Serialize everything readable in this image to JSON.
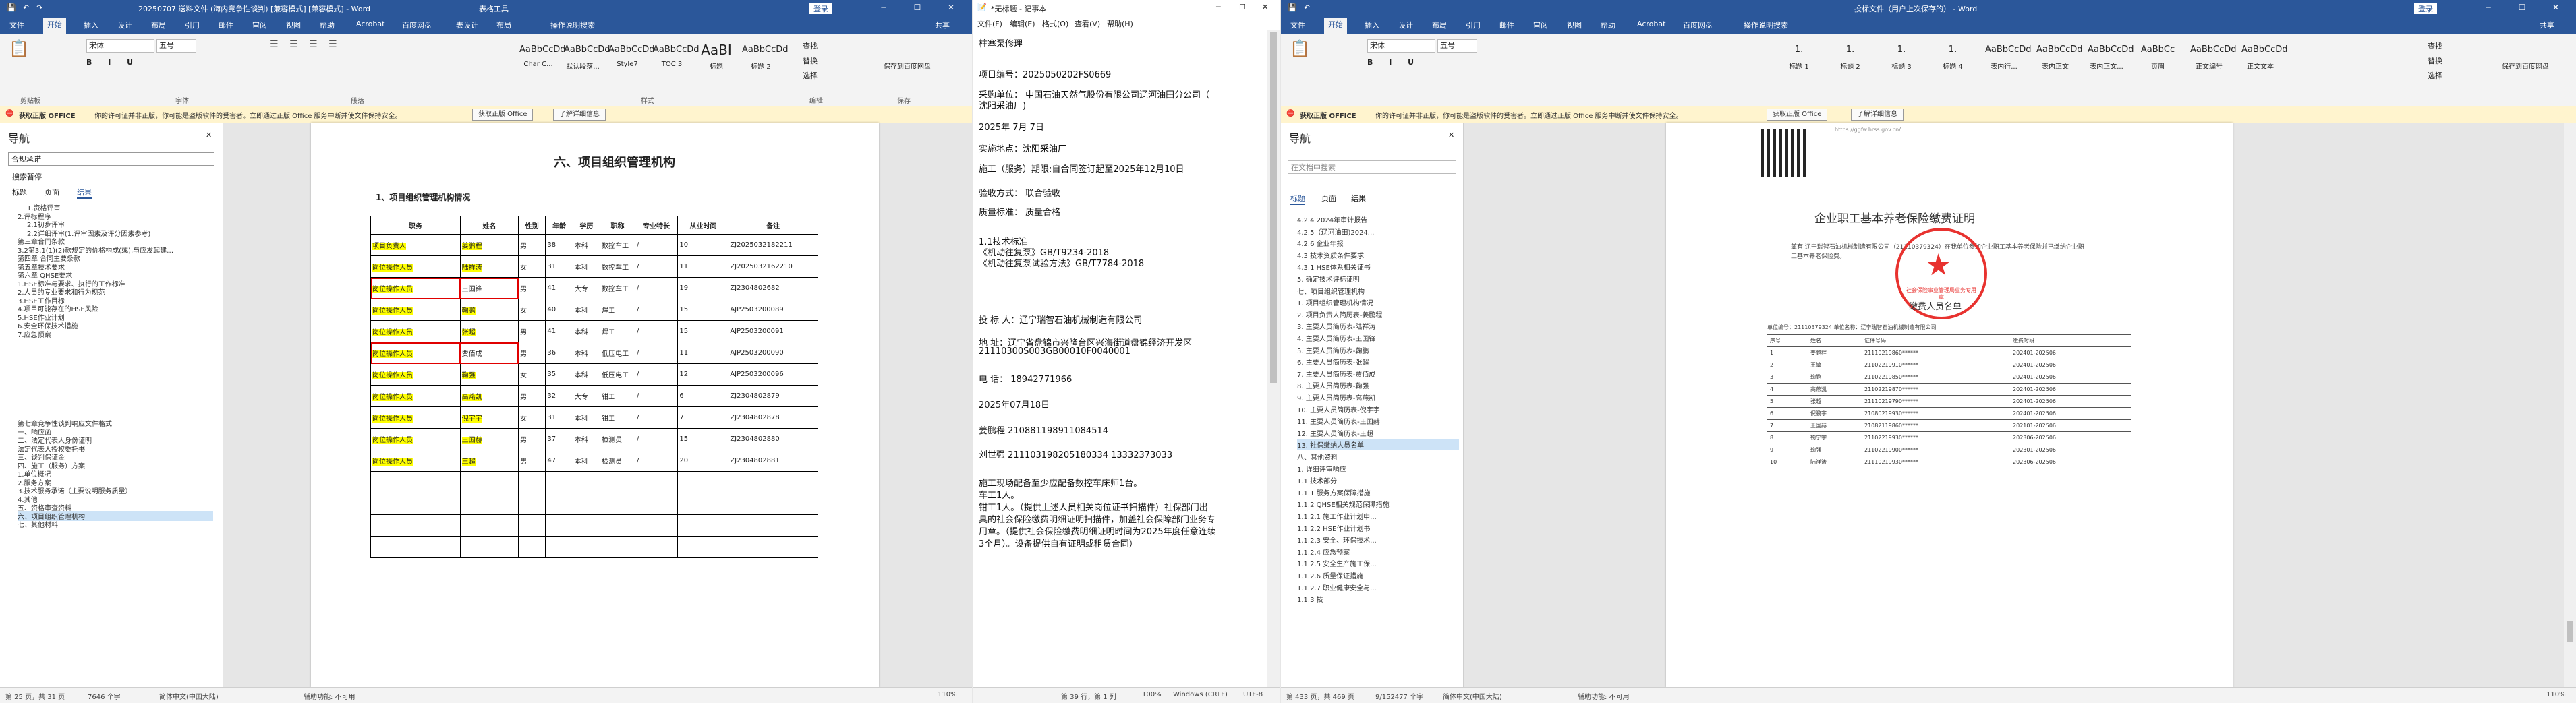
{
  "left_word": {
    "title": "20250707 送料文件 (海内竞争性谈判) [兼容模式] [兼容模式] - Word",
    "table_tools": "表格工具",
    "login": "登录",
    "tabs": [
      "文件",
      "开始",
      "插入",
      "设计",
      "布局",
      "引用",
      "邮件",
      "审阅",
      "视图",
      "帮助",
      "Acrobat",
      "百度网盘",
      "表设计",
      "布局"
    ],
    "active_tab": "开始",
    "tell_me": "操作说明搜索",
    "share": "共享",
    "font_name": "宋体",
    "font_size": "五号",
    "styles": [
      "AaBbCcDd",
      "AaBbCcDd",
      "AaBbCcDd",
      "AaBbCcDd",
      "AaBI",
      "AaBbCcDd"
    ],
    "style_names": [
      "Char C...",
      "默认段落...",
      "Style7",
      "TOC 3",
      "标题",
      "标题 2"
    ],
    "find": "查找",
    "replace": "替换",
    "select": "选择",
    "save_baidu": "保存到百度网盘",
    "groups": [
      "剪贴板",
      "字体",
      "段落",
      "样式",
      "编辑",
      "保存"
    ],
    "warning_title": "获取正版 OFFICE",
    "warning_text": "你的许可证并非正版，你可能是盗版软件的受害者。立即通过正版 Office 服务中断并使文件保持安全。",
    "warning_btn1": "获取正版 Office",
    "warning_btn2": "了解详细信息",
    "nav_title": "导航",
    "nav_search": "合规承诺",
    "nav_result": "搜索暂停",
    "nav_tabs": [
      "标题",
      "页面",
      "结果"
    ],
    "nav_items": [
      "1.资格评审",
      "2.评标程序",
      "2.1初步评审",
      "2.2详细评审(1.评审因素及评分因素参考)",
      "第三章合同条款",
      "3.2第3.1(1)(2)款规定的价格构成(或),与应发起建…",
      "第四章 合同主要条款",
      "第五章技术要求",
      "第六章 QHSE要求",
      "1.HSE标准与要求、执行的工作标准",
      "2.人员的专业要求和行为规范",
      "3.HSE工作目标",
      "4.项目可能存在的HSE风险",
      "5.HSE作业计划",
      "6.安全环保技术措施",
      "7.应急预案",
      "第七章竞争性谈判响应文件格式",
      "一、响应函",
      "二、法定代表人身份证明",
      "法定代表人授权委托书",
      "三、谈判保证金",
      "四、施工（服务）方案",
      "1.单位概况",
      "2.服务方案",
      "3.技术服务承诺（主要说明服务质量）",
      "4.其他",
      "五、资格审查资料",
      "六、项目组织管理机构",
      "七、其他材料"
    ],
    "selected_nav": "六、项目组织管理机构",
    "heading": "六、项目组织管理机构",
    "subheading": "1、项目组织管理机构情况",
    "table_headers": [
      "职务",
      "姓名",
      "性别",
      "年龄",
      "学历",
      "职称",
      "专业特长",
      "从业时间",
      "备注"
    ],
    "rows": [
      [
        "项目负责人",
        "姜鹏程",
        "男",
        "38",
        "本科",
        "数控车工",
        "/",
        "10",
        "ZJ2025032182211"
      ],
      [
        "岗位操作人员",
        "陆祥涛",
        "女",
        "31",
        "本科",
        "数控车工",
        "/",
        "11",
        "ZJ2025032162210"
      ],
      [
        "岗位操作人员",
        "王国锋",
        "男",
        "41",
        "大专",
        "数控车工",
        "/",
        "19",
        "ZJ2304802682"
      ],
      [
        "岗位操作人员",
        "鞠鹏",
        "女",
        "40",
        "本科",
        "焊工",
        "/",
        "15",
        "AJP2503200089"
      ],
      [
        "岗位操作人员",
        "张超",
        "男",
        "41",
        "本科",
        "焊工",
        "/",
        "15",
        "AJP2503200091"
      ],
      [
        "岗位操作人员",
        "贾佰成",
        "男",
        "36",
        "本科",
        "低压电工",
        "/",
        "11",
        "AJP2503200090"
      ],
      [
        "岗位操作人员",
        "鞠强",
        "女",
        "35",
        "本科",
        "低压电工",
        "/",
        "12",
        "AJP2503200096"
      ],
      [
        "岗位操作人员",
        "高燕凯",
        "男",
        "32",
        "大专",
        "钳工",
        "/",
        "6",
        "ZJ2304802879"
      ],
      [
        "岗位操作人员",
        "倪宇宇",
        "女",
        "31",
        "本科",
        "钳工",
        "/",
        "7",
        "ZJ2304802878"
      ],
      [
        "岗位操作人员",
        "王国赫",
        "男",
        "37",
        "本科",
        "检测员",
        "/",
        "15",
        "ZJ2304802880"
      ],
      [
        "岗位操作人员",
        "王超",
        "男",
        "47",
        "本科",
        "检测员",
        "/",
        "20",
        "ZJ2304802881"
      ]
    ],
    "status_page": "第 25 页，共 31 页",
    "status_words": "7646 个字",
    "status_lang": "简体中文(中国大陆)",
    "status_access": "辅助功能: 不可用",
    "status_zoom": "110%"
  },
  "notepad": {
    "title": "*无标题 - 记事本",
    "menu": [
      "文件(F)",
      "编辑(E)",
      "格式(O)",
      "查看(V)",
      "帮助(H)"
    ],
    "lines": [
      "柱塞泵修理",
      "项目编号：2025050202FS0669",
      "采购单位：  中国石油天然气股份有限公司辽河油田分公司（",
      "沈阳采油厂)",
      "2025年 7月 7日",
      "实施地点：沈阳采油厂",
      "施工（服务）期限:自合同签订起至2025年12月10日",
      "验收方式：     联合验收",
      "质量标准：    质量合格",
      "1.1技术标准",
      "《机动往复泵》GB/T9234-2018",
      "《机动往复泵试验方法》GB/T7784-2018",
      "投 标 人：辽宁瑞智石油机械制造有限公司",
      "地    址：辽宁省盘锦市兴隆台区兴海街道盘锦经济开发区",
      "21110300S003GB00010F0040001",
      "电    话： 18942771966",
      "2025年07月18日",
      "姜鹏程   210881198911084514",
      "刘世强   211103198205180334    13332373033",
      "施工现场配备至少应配备数控车床师1台。",
      "车工1人。",
      "钳工1人。（提供上述人员相关岗位证书扫描件）社保部门出",
      "具的社会保险缴费明细证明扫描件，加盖社会保障部门业务专",
      "用章。（提供社会保险缴费明细证明时间为2025年度任意连续",
      "3个月）。设备提供自有证明或租赁合同）"
    ],
    "status_pos": "第 39 行，第 1 列",
    "status_zoom": "100%",
    "status_eol": "Windows (CRLF)",
    "status_enc": "UTF-8"
  },
  "right_word": {
    "title": "投标文件（用户上次保存的） - Word",
    "login": "登录",
    "tabs": [
      "文件",
      "开始",
      "插入",
      "设计",
      "布局",
      "引用",
      "邮件",
      "审阅",
      "视图",
      "帮助",
      "Acrobat",
      "百度网盘"
    ],
    "active_tab": "开始",
    "tell_me": "操作说明搜索",
    "share": "共享",
    "font_name": "宋体",
    "font_size": "五号",
    "styles": [
      "1.",
      "1.",
      "1.",
      "1.",
      "AaBbCcDd",
      "AaBbCcDd",
      "AaBbCcDd",
      "AaBbCc",
      "AaBbCcDd",
      "AaBbCcDd"
    ],
    "style_names": [
      "标题 1",
      "标题 2",
      "标题 3",
      "标题 4",
      "表内行...",
      "表内正文",
      "表内正文...",
      "页眉",
      "正文编号",
      "正文文本"
    ],
    "find": "查找",
    "replace": "替换",
    "select": "选择",
    "save_baidu": "保存到百度网盘",
    "warning_title": "获取正版 OFFICE",
    "warning_text": "你的许可证并非正版，你可能是盗版软件的受害者。立即通过正版 Office 服务中断并使文件保持安全。",
    "warning_btn1": "获取正版 Office",
    "warning_btn2": "了解详细信息",
    "nav_title": "导航",
    "nav_search_placeholder": "在文档中搜索",
    "nav_tabs": [
      "标题",
      "页面",
      "结果"
    ],
    "nav_items": [
      "4.2.4 2024年审计报告",
      "4.2.5（辽河油田)2024...",
      "4.2.6 企业年报",
      "4.3 技术资质条件要求",
      "4.3.1 HSE体系相关证书",
      "5. 确定技术评标证明",
      "七、项目组织管理机构",
      "1. 项目组织管理机构情况",
      "2. 项目负责人简历表-姜鹏程",
      "3. 主要人员简历表-陆祥涛",
      "4. 主要人员简历表-王国锋",
      "5. 主要人员简历表-鞠鹏",
      "6. 主要人员简历表-张超",
      "7. 主要人员简历表-贾佰成",
      "8. 主要人员简历表-鞠强",
      "9. 主要人员简历表-高燕凯",
      "10. 主要人员简历表-倪宇宇",
      "11. 主要人员简历表-王国赫",
      "12. 主要人员简历表-王超",
      "13. 社保缴纳人员名单",
      "八、其他资料",
      "1. 详细评审响应",
      "1.1 技术部分",
      "1.1.1 服务方案保障措施",
      "1.1.2 QHSE相关规范保障措施",
      "1.1.2.1 施工作业计划申...",
      "1.1.2.2 HSE作业计划书",
      "1.1.2.3 安全、环保技术...",
      "1.1.2.4 应急预案",
      "1.1.2.5 安全生产施工保...",
      "1.1.2.6 质量保证措施",
      "1.1.2.7 职业健康安全与...",
      "1.1.3 技"
    ],
    "selected_nav": "13. 社保缴纳人员名单",
    "cert_url": "https://ggfw.hrss.gov.cn/...",
    "cert_title": "企业职工基本养老保险缴费证明",
    "cert_para": "兹有 辽宁瑞智石油机械制造有限公司（21110379324）在我单位参加企业职工基本养老保险并已缴纳企业职工基本养老保险费。",
    "seal_text": "社会保险事业管理局业务专用章",
    "list_title": "缴费人员名单",
    "list_meta": "单位编号：21110379324     单位名称：辽宁瑞智石油机械制造有限公司",
    "list_headers": [
      "序号",
      "姓名",
      "证件号码",
      "缴费时段"
    ],
    "list_rows": [
      [
        "1",
        "姜鹏程",
        "21110219860******",
        "202401-202506"
      ],
      [
        "2",
        "王敏",
        "21102219910******",
        "202401-202506"
      ],
      [
        "3",
        "鞠鹏",
        "21102219850******",
        "202401-202506"
      ],
      [
        "4",
        "高燕凯",
        "21102219870******",
        "202401-202506"
      ],
      [
        "5",
        "张超",
        "21110219790******",
        "202401-202506"
      ],
      [
        "6",
        "倪鹏宇",
        "21080219930******",
        "202401-202506"
      ],
      [
        "7",
        "王国赫",
        "21082119860******",
        "202101-202506"
      ],
      [
        "8",
        "鞠宁宇",
        "21102219930******",
        "202306-202506"
      ],
      [
        "9",
        "鞠强",
        "21102219900******",
        "202301-202506"
      ],
      [
        "10",
        "陆祥涛",
        "21110219930******",
        "202306-202506"
      ]
    ],
    "status_page": "第 433 页，共 469 页",
    "status_words": "9/152477 个字",
    "status_lang": "简体中文(中国大陆)",
    "status_access": "辅助功能: 不可用",
    "status_zoom": "110%"
  },
  "colors": {
    "word_blue": "#2b579a",
    "highlight": "#ffff00",
    "red_box": "#e00000",
    "seal_red": "#e8322f"
  }
}
